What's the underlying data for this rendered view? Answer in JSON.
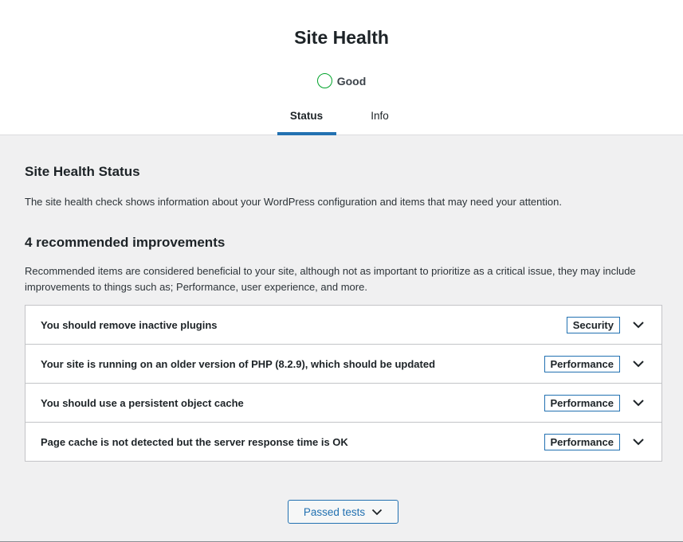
{
  "page": {
    "title": "Site Health",
    "status_label": "Good",
    "status_color": "#00a32a"
  },
  "tabs": [
    {
      "label": "Status",
      "active": true
    },
    {
      "label": "Info",
      "active": false
    }
  ],
  "status_section": {
    "heading": "Site Health Status",
    "description": "The site health check shows information about your WordPress configuration and items that may need your attention."
  },
  "improvements": {
    "count_label": "4 recommended improvements",
    "description": "Recommended items are considered beneficial to your site, although not as important to prioritize as a critical issue, they may include improvements to things such as; Performance, user experience, and more.",
    "items": [
      {
        "title": "You should remove inactive plugins",
        "badge": "Security",
        "icon": "chevron-down-icon"
      },
      {
        "title": "Your site is running on an older version of PHP (8.2.9), which should be updated",
        "badge": "Performance",
        "icon": "chevron-down-icon"
      },
      {
        "title": "You should use a persistent object cache",
        "badge": "Performance",
        "icon": "chevron-down-icon"
      },
      {
        "title": "Page cache is not detected but the server response time is OK",
        "badge": "Performance",
        "icon": "chevron-down-icon"
      }
    ]
  },
  "passed_tests": {
    "label": "Passed tests",
    "icon": "chevron-down-icon"
  },
  "colors": {
    "accent": "#2271b1",
    "good": "#00a32a"
  }
}
